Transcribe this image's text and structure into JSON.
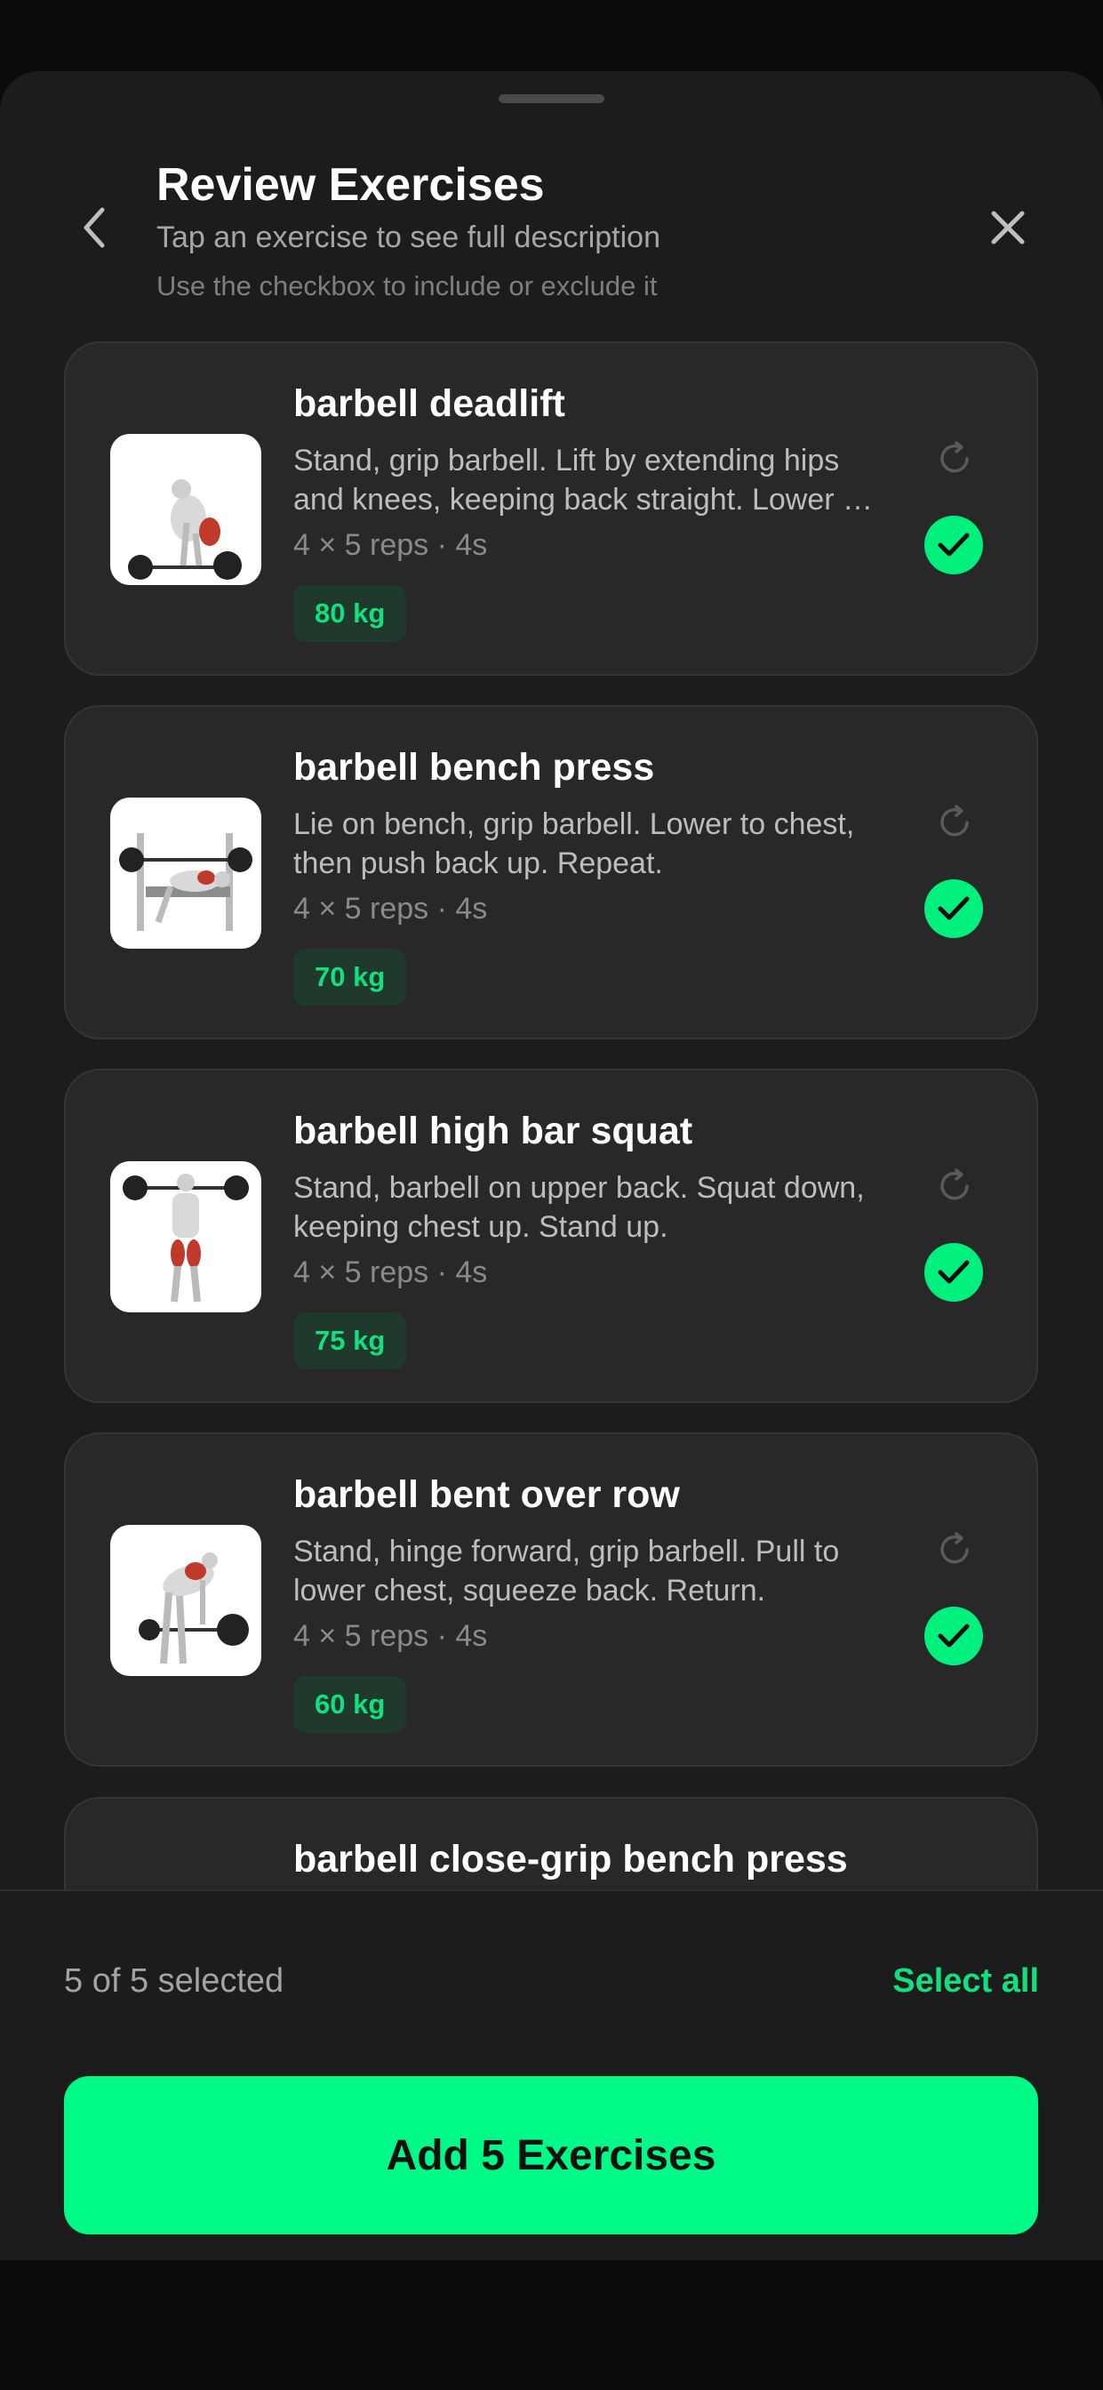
{
  "header": {
    "title": "Review Exercises",
    "subtitle": "Tap an exercise to see full description",
    "hint": "Use the checkbox to include or exclude it"
  },
  "exercises": [
    {
      "name": "barbell deadlift",
      "description": "Stand, grip barbell. Lift by extending hips and knees, keeping back straight. Lower bar to floor.",
      "meta": "4 × 5 reps · 4s",
      "weight": "80 kg",
      "selected": true
    },
    {
      "name": "barbell bench press",
      "description": "Lie on bench, grip barbell. Lower to chest, then push back up. Repeat.",
      "meta": "4 × 5 reps · 4s",
      "weight": "70 kg",
      "selected": true
    },
    {
      "name": "barbell high bar squat",
      "description": "Stand, barbell on upper back. Squat down, keeping chest up. Stand up.",
      "meta": "4 × 5 reps · 4s",
      "weight": "75 kg",
      "selected": true
    },
    {
      "name": "barbell bent over row",
      "description": "Stand, hinge forward, grip barbell. Pull to lower chest, squeeze back. Return.",
      "meta": "4 × 5 reps · 4s",
      "weight": "60 kg",
      "selected": true
    },
    {
      "name": "barbell close-grip bench press"
    }
  ],
  "footer": {
    "count_label": "5 of 5 selected",
    "select_all_label": "Select all",
    "add_button_label": "Add 5 Exercises"
  },
  "colors": {
    "accent": "#00fa87",
    "card_background": "#282828",
    "sheet_background": "#1c1c1c"
  },
  "icons": [
    "chevron-left-icon",
    "close-icon",
    "swap-icon",
    "checkmark-icon"
  ]
}
